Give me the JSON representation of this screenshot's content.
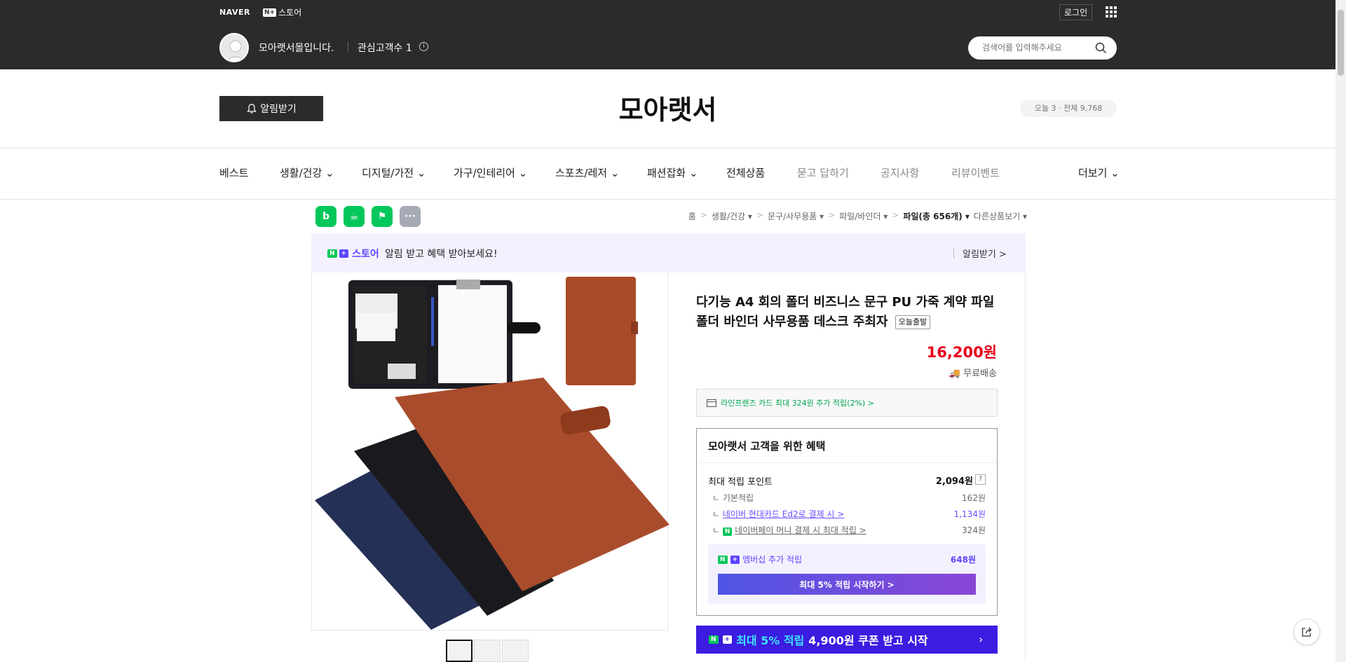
{
  "top": {
    "naver_logo": "NAVER",
    "nstore_label": "스토어",
    "login": "로그인",
    "store_greeting": "모아랫서몰입니다.",
    "interest": "관심고객수 1",
    "search_placeholder": "검색어를 입력해주세요"
  },
  "store": {
    "alarm_button": "알림받기",
    "title": "모아랫서",
    "visit": "오늘 3 · 전체 9,768"
  },
  "nav": {
    "items": [
      "베스트",
      "생활/건강",
      "디지털/가전",
      "가구/인테리어",
      "스포츠/레저",
      "패션잡화",
      "전체상품",
      "묻고 답하기",
      "공지사항",
      "리뷰이벤트"
    ],
    "more": "더보기"
  },
  "breadcrumb": [
    "홈",
    "생활/건강",
    "문구/사무용품",
    "파일/바인더",
    "파일(총 656개)",
    "다른상품보기"
  ],
  "banner": {
    "store": "스토어",
    "text": "알림 받고 혜택 받아보세요!",
    "link": "알림받기 >"
  },
  "product": {
    "title": "다기능 A4 회의 폴더 비즈니스 문구 PU 가죽 계약 파일 폴더 바인더 사무용품 데스크 주최자",
    "badge": "오늘출발",
    "price": "16,200원",
    "shipping": "무료배송",
    "card_promo": "라인프렌즈 카드 최대 324원 추가 적립(2%) >"
  },
  "benefits": {
    "title": "모아랫서 고객을 위한 혜택",
    "max_point_label": "최대 적립 포인트",
    "max_point_value": "2,094원",
    "rows": [
      {
        "label": "기본적립",
        "value": "162원"
      },
      {
        "label": "네이버 현대카드 Ed2로 결제 시 >",
        "value": "1,134원"
      },
      {
        "label": "네이버페이 머니 결제 시 최대 적립 >",
        "value": "324원"
      }
    ],
    "membership_label": "멤버십 추가 적립",
    "membership_value": "648원",
    "membership_button": "최대 5% 적립 시작하기 >"
  },
  "coupon": {
    "t1": "최대 5% 적립",
    "t2": "4,900원 쿠폰 받고 시작"
  },
  "colors": {
    "dark_header": "#2b2b2b",
    "price_red": "#e8001b",
    "naver_green": "#03c75a",
    "purple": "#5a46ff"
  }
}
